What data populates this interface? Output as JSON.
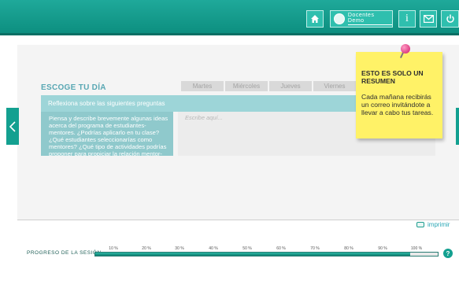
{
  "topbar": {
    "user_name": "Docentes Demo",
    "icons": [
      "home-icon",
      "user-avatar",
      "info-icon",
      "mail-icon",
      "power-icon"
    ],
    "info_glyph": "i",
    "accent": "#13a090"
  },
  "main": {
    "section_title": "ESCOGE TU DÍA",
    "day_tabs": [
      "Martes",
      "Miércoles",
      "Jueves",
      "Viernes"
    ],
    "reflect_prompt": "Reflexiona sobre las siguientes preguntas",
    "question": "Piensa y describe brevemente algunas ideas acerca del programa de estudiantes-mentores. ¿Podrías aplicarlo en tu clase? ¿Qué estudiantes seleccionarías como mentores? ¿Qué tipo de actividades podrías proponer para propiciar la relación mentor-estudiante?",
    "answer_placeholder": "Escribe aquí..."
  },
  "note": {
    "title": "ESTO ES SOLO UN RESUMEN",
    "body": "Cada mañana recibirás un correo invitándote a llevar a cabo tus tareas."
  },
  "print": {
    "label": "imprimir"
  },
  "progress": {
    "label": "PROGRESO DE LA SESIÓN",
    "ticks": [
      "10 %",
      "20 %",
      "30 %",
      "40 %",
      "50 %",
      "60 %",
      "70 %",
      "80 %",
      "90 %",
      "100 %"
    ],
    "percent": 92,
    "help": "?"
  }
}
